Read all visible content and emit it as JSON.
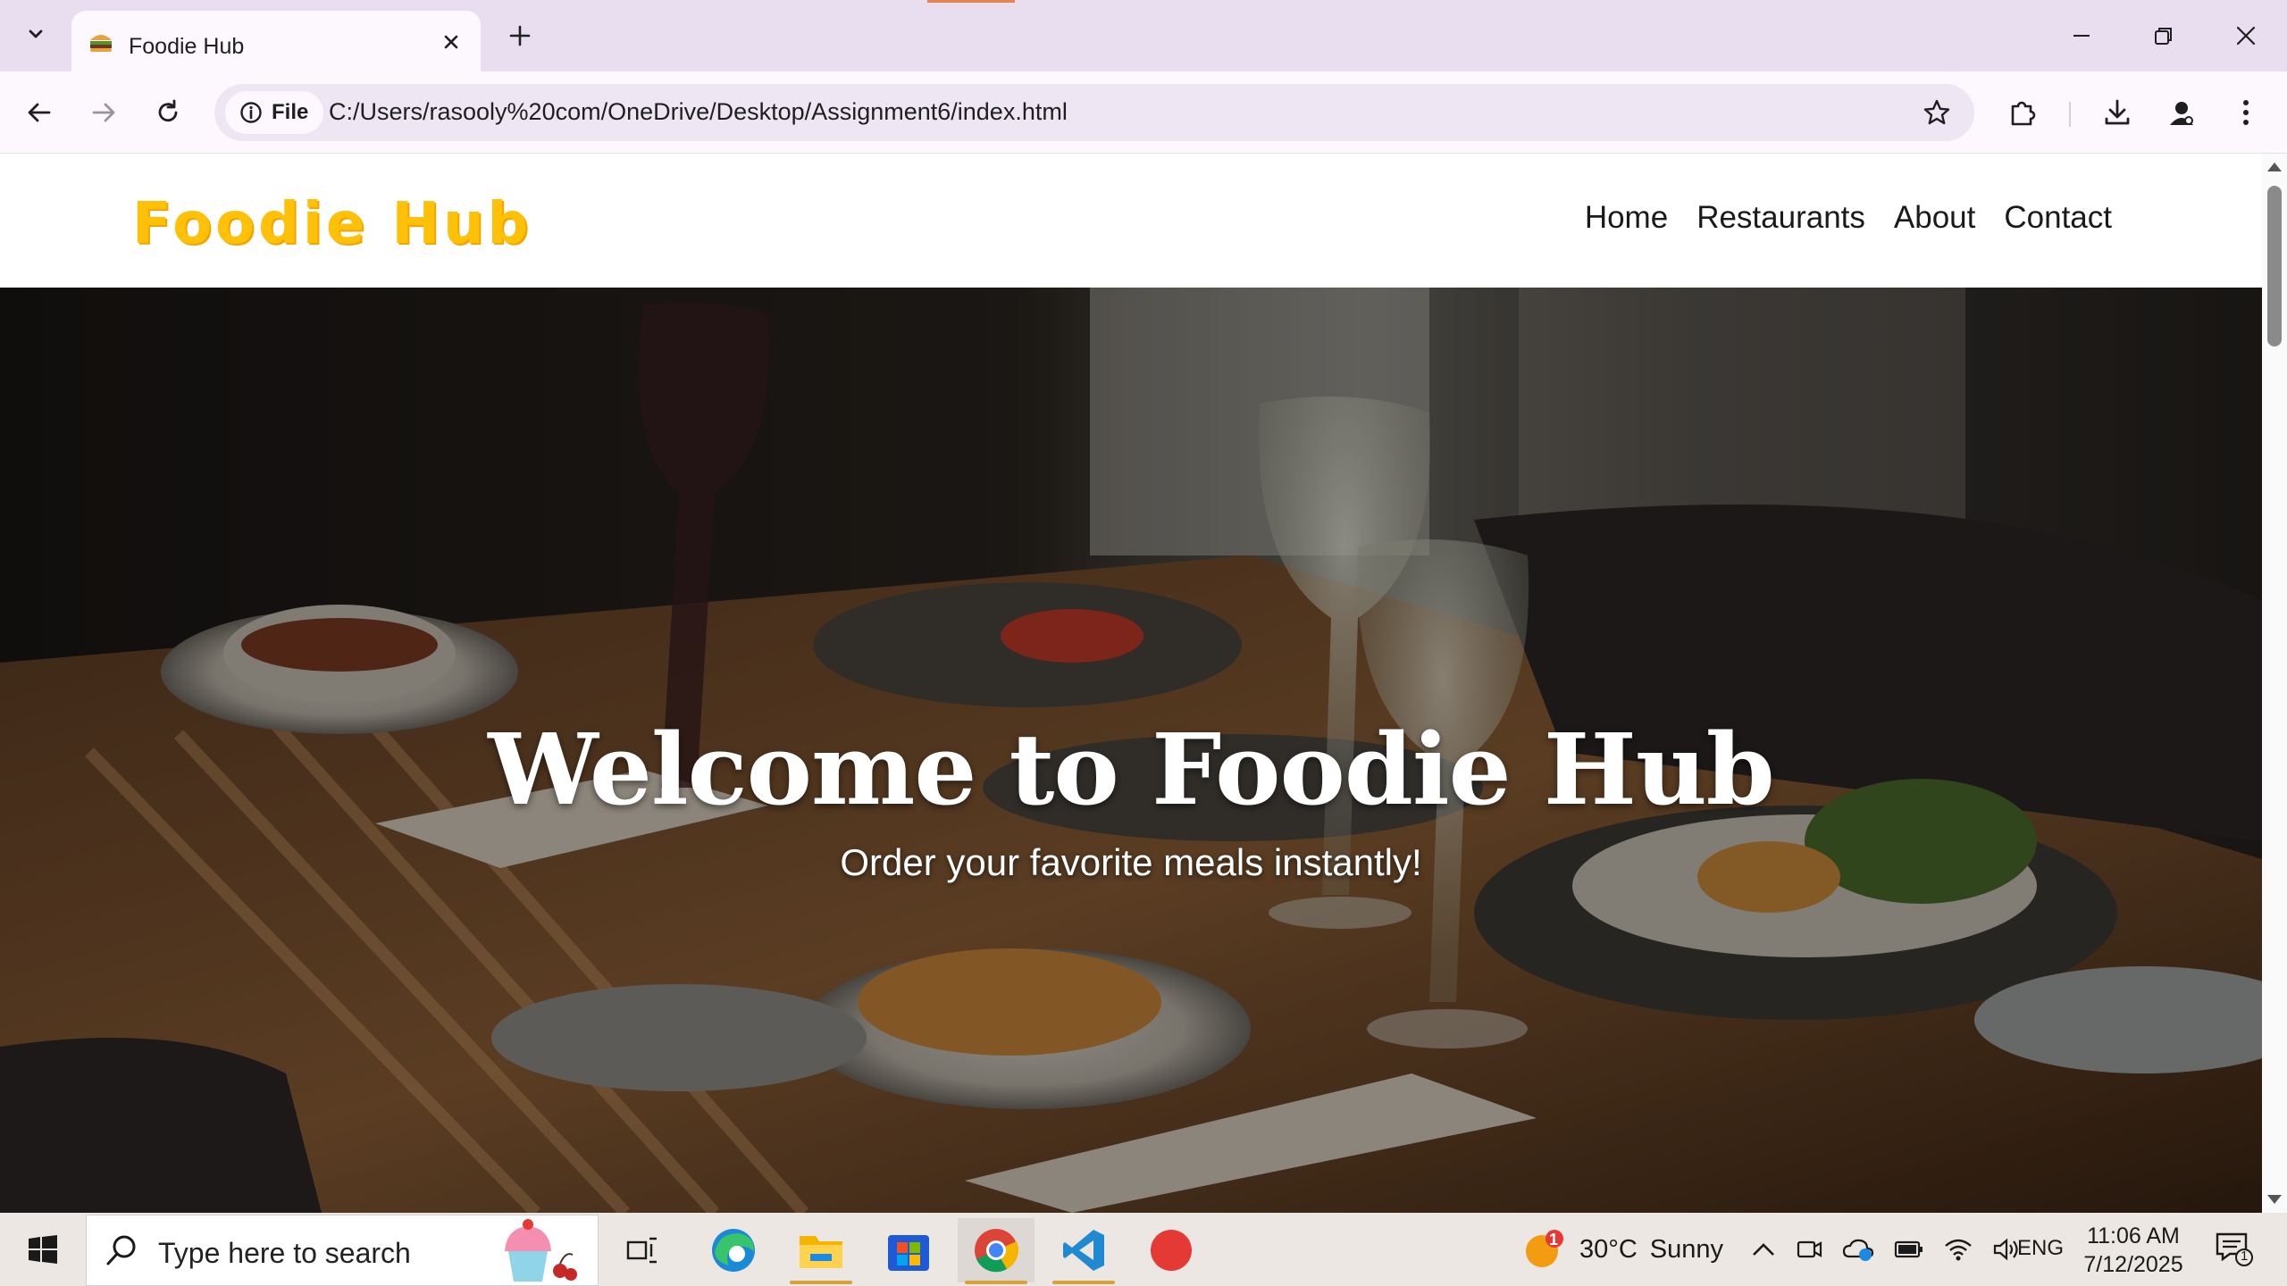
{
  "browser": {
    "tab": {
      "title": "Foodie Hub"
    },
    "omnibox": {
      "chip_label": "File",
      "url": "C:/Users/rasooly%20com/OneDrive/Desktop/Assignment6/index.html"
    }
  },
  "site": {
    "logo": "Foodie Hub",
    "nav": [
      "Home",
      "Restaurants",
      "About",
      "Contact"
    ],
    "hero": {
      "title": "Welcome to Foodie Hub",
      "subtitle": "Order your favorite meals instantly!"
    }
  },
  "taskbar": {
    "search_placeholder": "Type here to search",
    "weather": {
      "badge": "1",
      "temp": "30°C",
      "condition": "Sunny"
    },
    "language": "ENG",
    "clock": {
      "time": "11:06 AM",
      "date": "7/12/2025"
    },
    "notification_count": "1"
  },
  "colors": {
    "logo": "#ffc107",
    "tabstrip": "#e9ddf0",
    "taskbar": "#ece7e2"
  }
}
